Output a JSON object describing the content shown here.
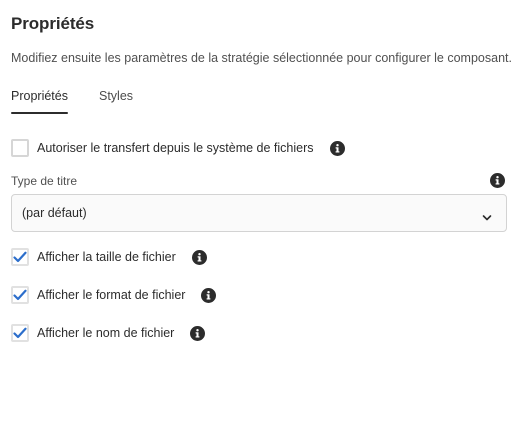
{
  "header": {
    "title": "Propriétés",
    "description": "Modifiez ensuite les paramètres de la stratégie sélectionnée pour configurer le composant."
  },
  "tabs": [
    {
      "label": "Propriétés",
      "active": true
    },
    {
      "label": "Styles",
      "active": false
    }
  ],
  "options": {
    "allow_upload": {
      "label": "Autoriser le transfert depuis le système de fichiers",
      "checked": false,
      "icon": "info-icon"
    },
    "show_size": {
      "label": "Afficher la taille de fichier",
      "checked": true,
      "icon": "info-icon"
    },
    "show_format": {
      "label": "Afficher le format de fichier",
      "checked": true,
      "icon": "info-icon"
    },
    "show_name": {
      "label": "Afficher le nom de fichier",
      "checked": true,
      "icon": "info-icon"
    }
  },
  "title_type": {
    "label": "Type de titre",
    "selected": "(par défaut)",
    "icon": "info-icon"
  },
  "colors": {
    "accent": "#2c6ecb",
    "text": "#2c2c2c",
    "border": "#d3d3d3"
  }
}
